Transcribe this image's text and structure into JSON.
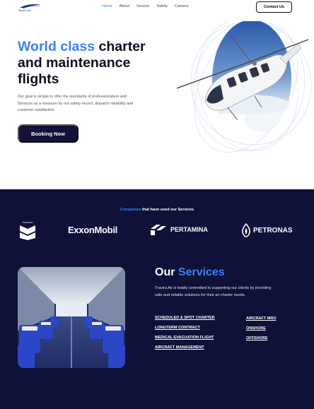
{
  "header": {
    "logo_text": "Travira Air",
    "nav": [
      {
        "label": "Home",
        "active": true
      },
      {
        "label": "About",
        "active": false
      },
      {
        "label": "Service",
        "active": false
      },
      {
        "label": "Safety",
        "active": false
      },
      {
        "label": "Careers",
        "active": false
      }
    ],
    "contact_label": "Contact Us"
  },
  "hero": {
    "title_accent": "World class",
    "title_rest": " charter and maintenance flights",
    "description": "Our goal is simple to offer the standards of professionalism and Services as a measure by our safety record, dispatch reliability and customer satisfaction",
    "booking_label": "Booking Now"
  },
  "companies": {
    "title_accent": "Companies",
    "title_rest": " that have used our Services",
    "logos": [
      "Chevron",
      "ExxonMobil",
      "PERTAMINA",
      "PETRONAS"
    ]
  },
  "services": {
    "title_plain": "Our",
    "title_accent": " Services",
    "description": "Travira Air is totally committed to supporting our clients by providing safe and reliable solutions for their air charter needs.",
    "column1": [
      "SCHEDULED & SPOT CHARTER",
      "LONGTERM CONTRACT",
      "MEDICAL EVACUATION FLIGHT",
      "AIRCRAFT MANAGEMENT"
    ],
    "column2": [
      "AIRCRAFT MRO",
      "ONSHORE",
      "OFFSHORE"
    ]
  },
  "colors": {
    "accent": "#3b82f6",
    "dark_navy": "#0f1138",
    "button_navy": "#13123a"
  }
}
